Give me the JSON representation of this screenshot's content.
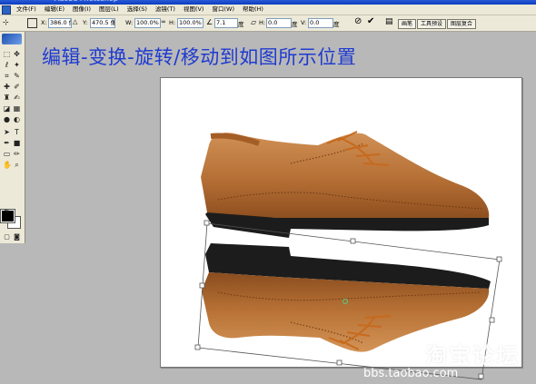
{
  "menus": [
    "文件(F)",
    "编辑(E)",
    "图像(I)",
    "图层(L)",
    "选择(S)",
    "滤镜(T)",
    "视图(V)",
    "窗口(W)",
    "帮助(H)"
  ],
  "options": {
    "x_label": "X:",
    "x_value": "386.0 像",
    "y_label": "Y:",
    "y_value": "470.5 像",
    "w_label": "W:",
    "w_value": "100.0%",
    "h_label": "H:",
    "h_value": "100.0%",
    "angle_value": "7.1",
    "angle_unit": "度",
    "hskew_label": "H:",
    "hskew_value": "0.0",
    "hskew_unit": "度",
    "vskew_label": "V:",
    "vskew_value": "0.0",
    "vskew_unit": "度"
  },
  "palette_tabs": [
    "画笔",
    "工具预设",
    "图层复合"
  ],
  "instruction": "编辑-变换-旋转/移动到如图所示位置",
  "watermark": {
    "text": "淘宝论坛",
    "url": "bbs.taobao.com"
  }
}
